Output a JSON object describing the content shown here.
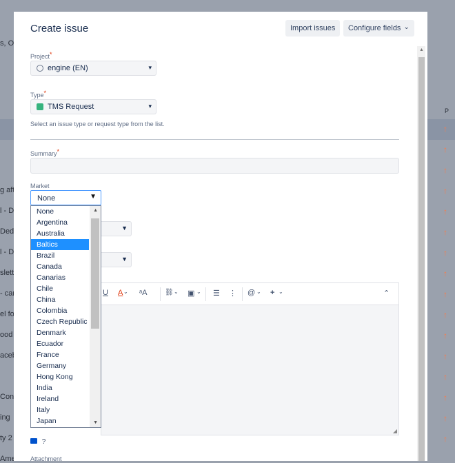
{
  "background": {
    "left_fragments": [
      "s, O...",
      "g aft",
      "l - D",
      "Dedu",
      "l - D",
      "slett",
      "- car",
      "el for",
      "ood",
      "acebo",
      "Conn",
      "ing",
      "ty 2",
      "Ame"
    ],
    "column_header": "P",
    "arrow_glyph": "↑",
    "arrow_color": "#ff7a45"
  },
  "modal": {
    "title": "Create issue",
    "import_label": "Import issues",
    "configure_label": "Configure fields",
    "configure_caret": "⌄"
  },
  "project": {
    "label": "Project",
    "required": "*",
    "value": "engine (EN)",
    "icon": "volkswagen-logo-icon"
  },
  "type": {
    "label": "Type",
    "required": "*",
    "value": "TMS Request",
    "icon": "request-type-icon",
    "hint": "Select an issue type or request type from the list."
  },
  "summary": {
    "label": "Summary",
    "required": "*",
    "value": ""
  },
  "market": {
    "label": "Market",
    "value": "None",
    "options": [
      "None",
      "Argentina",
      "Australia",
      "Baltics",
      "Brazil",
      "Canada",
      "Canarias",
      "Chile",
      "China",
      "Colombia",
      "Czech Republic",
      "Denmark",
      "Ecuador",
      "France",
      "Germany",
      "Hong Kong",
      "India",
      "Ireland",
      "Italy",
      "Japan"
    ],
    "highlighted": "Baltics"
  },
  "toolbar": {
    "underline": "U",
    "text_color": "A",
    "more_format": "ᵃA",
    "link": "🔗",
    "attach_icon": "▣",
    "bullet_list": "☰",
    "numbered_list": "⋮",
    "mention": "@",
    "insert": "+",
    "collapse": "⌃"
  },
  "footer": {
    "attachment_label": "Attachment"
  },
  "colors": {
    "accent": "#4c9aff",
    "selected_option": "#1e90ff",
    "required": "#de350b"
  }
}
